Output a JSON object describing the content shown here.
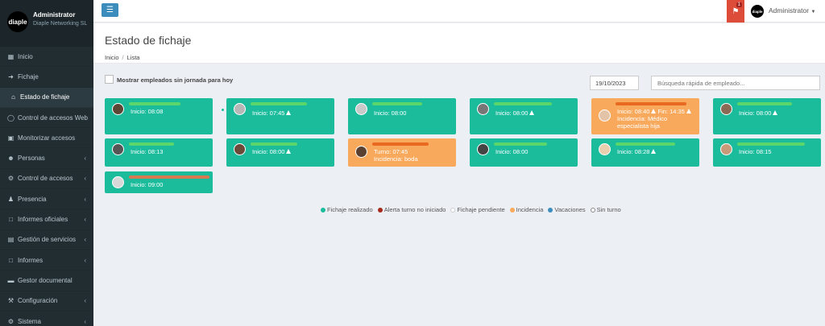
{
  "sidebar": {
    "user_name": "Administrator",
    "user_org": "Diaple Networking SL",
    "logo_text": "diaple",
    "items": [
      {
        "label": "Inicio",
        "icon": "grid-icon",
        "chevron": false
      },
      {
        "label": "Fichaje",
        "icon": "sign-in-icon",
        "chevron": false
      },
      {
        "label": "Estado de fichaje",
        "icon": "home-icon",
        "chevron": false,
        "active": true
      },
      {
        "label": "Control de accesos Web",
        "icon": "circle-icon",
        "chevron": false
      },
      {
        "label": "Monitorizar accesos",
        "icon": "monitor-icon",
        "chevron": false
      },
      {
        "label": "Personas",
        "icon": "users-icon",
        "chevron": true
      },
      {
        "label": "Control de accesos",
        "icon": "gear-icon",
        "chevron": true
      },
      {
        "label": "Presencia",
        "icon": "user-icon",
        "chevron": true
      },
      {
        "label": "Informes oficiales",
        "icon": "file-icon",
        "chevron": true
      },
      {
        "label": "Gestión de servicios",
        "icon": "list-icon",
        "chevron": true
      },
      {
        "label": "Informes",
        "icon": "file-icon",
        "chevron": true
      },
      {
        "label": "Gestor documental",
        "icon": "folder-icon",
        "chevron": false
      },
      {
        "label": "Configuración",
        "icon": "wrench-icon",
        "chevron": true
      },
      {
        "label": "Sistema",
        "icon": "gear-icon",
        "chevron": true
      }
    ]
  },
  "topbar": {
    "notifications": "1",
    "user_label": "Administrator",
    "avatar_text": "diaple"
  },
  "page": {
    "title": "Estado de fichaje",
    "breadcrumb_home": "Inicio",
    "breadcrumb_current": "Lista"
  },
  "filters": {
    "show_without_shift_label": "Mostrar empleados sin jornada para hoy",
    "date_value": "19/10/2023",
    "search_placeholder": "Búsqueda rápida de empleado..."
  },
  "cards": [
    {
      "status": "green",
      "line1": "Inicio: 08:08",
      "warn": false
    },
    {
      "status": "green",
      "line1": "Inicio: 07:45",
      "warn": true
    },
    {
      "status": "green",
      "line1": "Inicio: 08:00",
      "warn": false
    },
    {
      "status": "green",
      "line1": "Inicio: 08:00",
      "warn": true
    },
    {
      "status": "orange",
      "line1": "Inicio: 08:40",
      "line1b": "Fin: 14:35",
      "line2": "Incidencia: Médico",
      "line3": "especialista hija",
      "warn": true
    },
    {
      "status": "green",
      "line1": "Inicio: 08:00",
      "warn": true
    },
    {
      "status": "green",
      "line1": "Inicio: 08:13",
      "warn": false
    },
    {
      "status": "green",
      "line1": "Inicio: 08:00",
      "warn": true
    },
    {
      "status": "orange",
      "line1": "Turno: 07:45",
      "line2": "Incidencia: boda",
      "warn": false
    },
    {
      "status": "green",
      "line1": "Inicio: 08:00",
      "warn": false
    },
    {
      "status": "green",
      "line1": "Inicio: 08:28",
      "warn": true
    },
    {
      "status": "green",
      "line1": "Inicio: 08:15",
      "warn": false
    },
    {
      "status": "green",
      "line1": "Inicio: 09:00",
      "warn": false
    }
  ],
  "legend": [
    {
      "label": "Fichaje realizado",
      "color": "#1abc9c"
    },
    {
      "label": "Alerta turno no iniciado",
      "color": "#a52a1a"
    },
    {
      "label": "Fichaje pendiente",
      "color": "#ffffff"
    },
    {
      "label": "Incidencia",
      "color": "#f8a95c"
    },
    {
      "label": "Vacaciones",
      "color": "#3c8dbc"
    },
    {
      "label": "Sin turno",
      "color": "#ffffff"
    }
  ]
}
